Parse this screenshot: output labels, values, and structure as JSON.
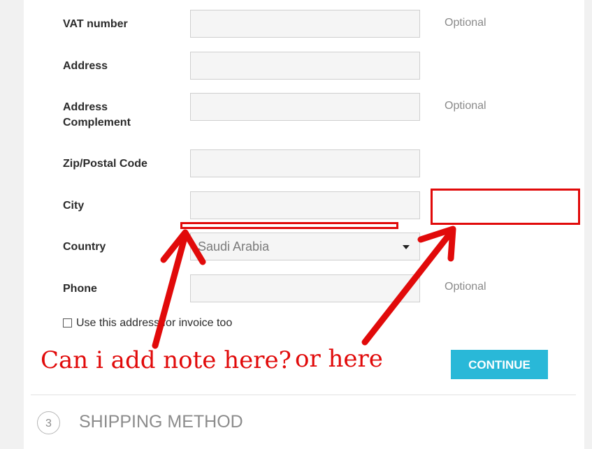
{
  "form": {
    "vat_label": "VAT number",
    "address_label": "Address",
    "address_complement_label": "Address\nComplement",
    "zip_label": "Zip/Postal Code",
    "city_label": "City",
    "country_label": "Country",
    "phone_label": "Phone",
    "optional_text": "Optional",
    "country_value": "Saudi Arabia",
    "invoice_checkbox_label": "Use this address for invoice too",
    "invoice_checked": false,
    "continue_label": "CONTINUE"
  },
  "next_step": {
    "number": "3",
    "title": "SHIPPING METHOD"
  },
  "annotations": {
    "note_question": "Can i add note here?",
    "or_here": "or here",
    "color": "#e10a0a"
  },
  "colors": {
    "continue_button": "#29b8d8",
    "field_background": "#f5f5f5"
  },
  "icons": {
    "country_dropdown": "caret-down-icon"
  }
}
